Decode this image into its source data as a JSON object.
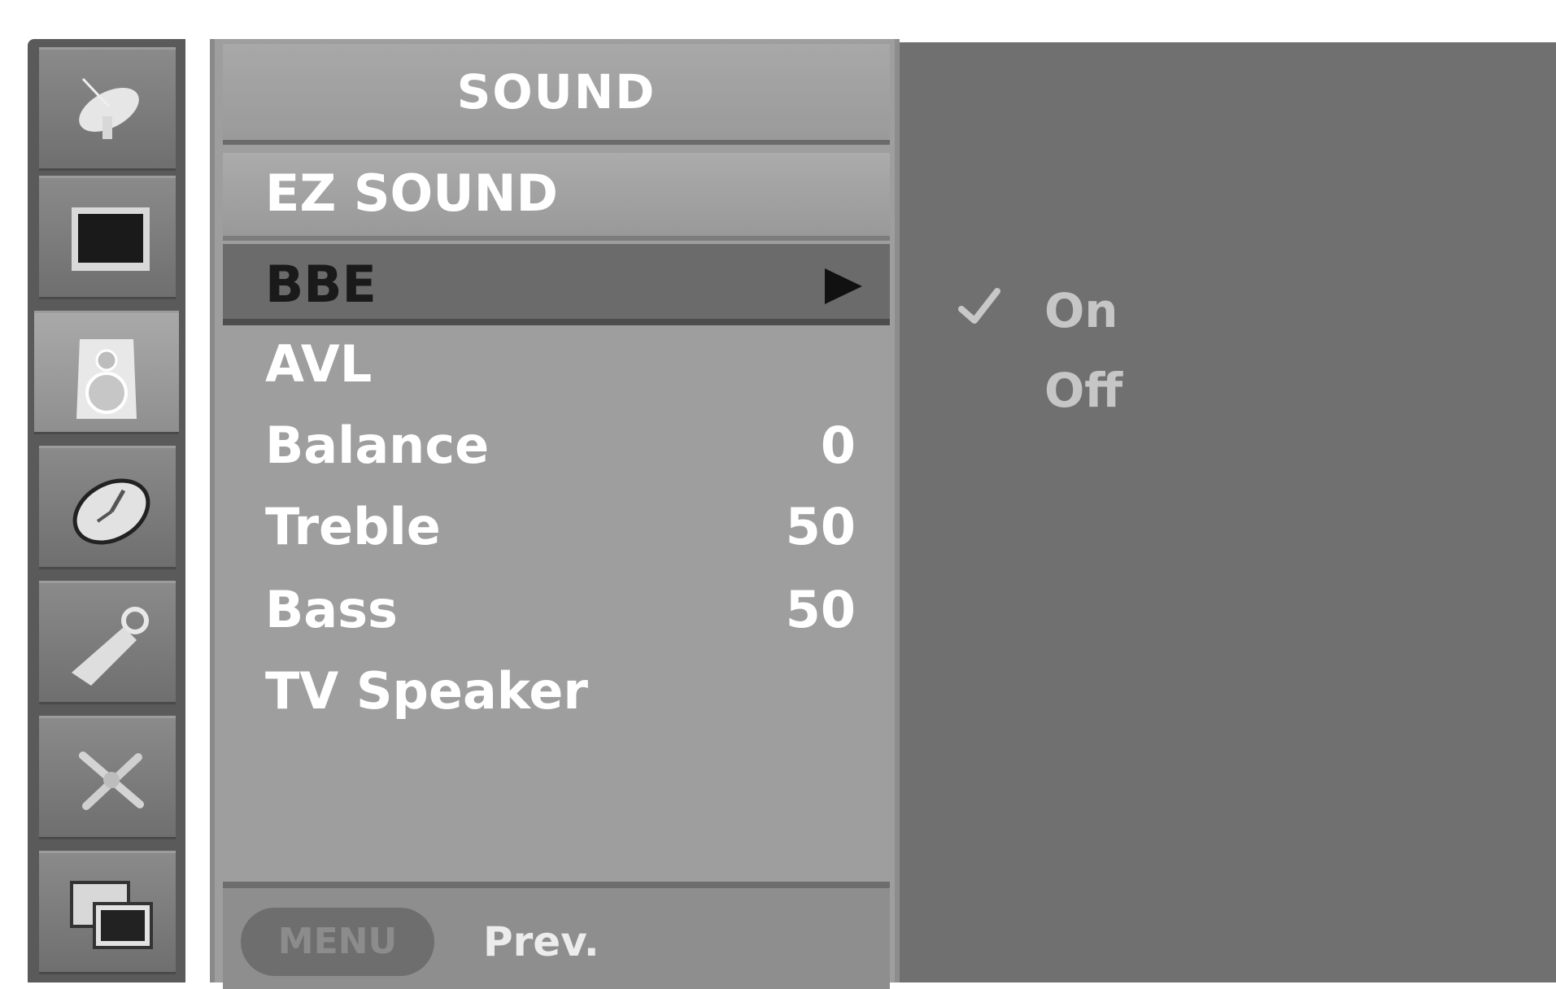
{
  "sidebar": {
    "icons": [
      {
        "name": "antenna-dish-icon"
      },
      {
        "name": "picture-screen-icon"
      },
      {
        "name": "speaker-icon"
      },
      {
        "name": "clock-icon"
      },
      {
        "name": "key-tag-icon"
      },
      {
        "name": "tools-icon"
      },
      {
        "name": "pip-icon"
      }
    ],
    "active_index": 2
  },
  "menu": {
    "title": "SOUND",
    "items": [
      {
        "label": "EZ SOUND",
        "value": ""
      },
      {
        "label": "BBE",
        "value": ""
      },
      {
        "label": "AVL",
        "value": ""
      },
      {
        "label": "Balance",
        "value": "0"
      },
      {
        "label": "Treble",
        "value": "50"
      },
      {
        "label": "Bass",
        "value": "50"
      },
      {
        "label": "TV Speaker",
        "value": ""
      }
    ],
    "selected_item": "BBE"
  },
  "footer": {
    "menu_button": "MENU",
    "prev_label": "Prev."
  },
  "submenu": {
    "options": [
      {
        "label": "On",
        "checked": true
      },
      {
        "label": "Off",
        "checked": false
      }
    ]
  }
}
